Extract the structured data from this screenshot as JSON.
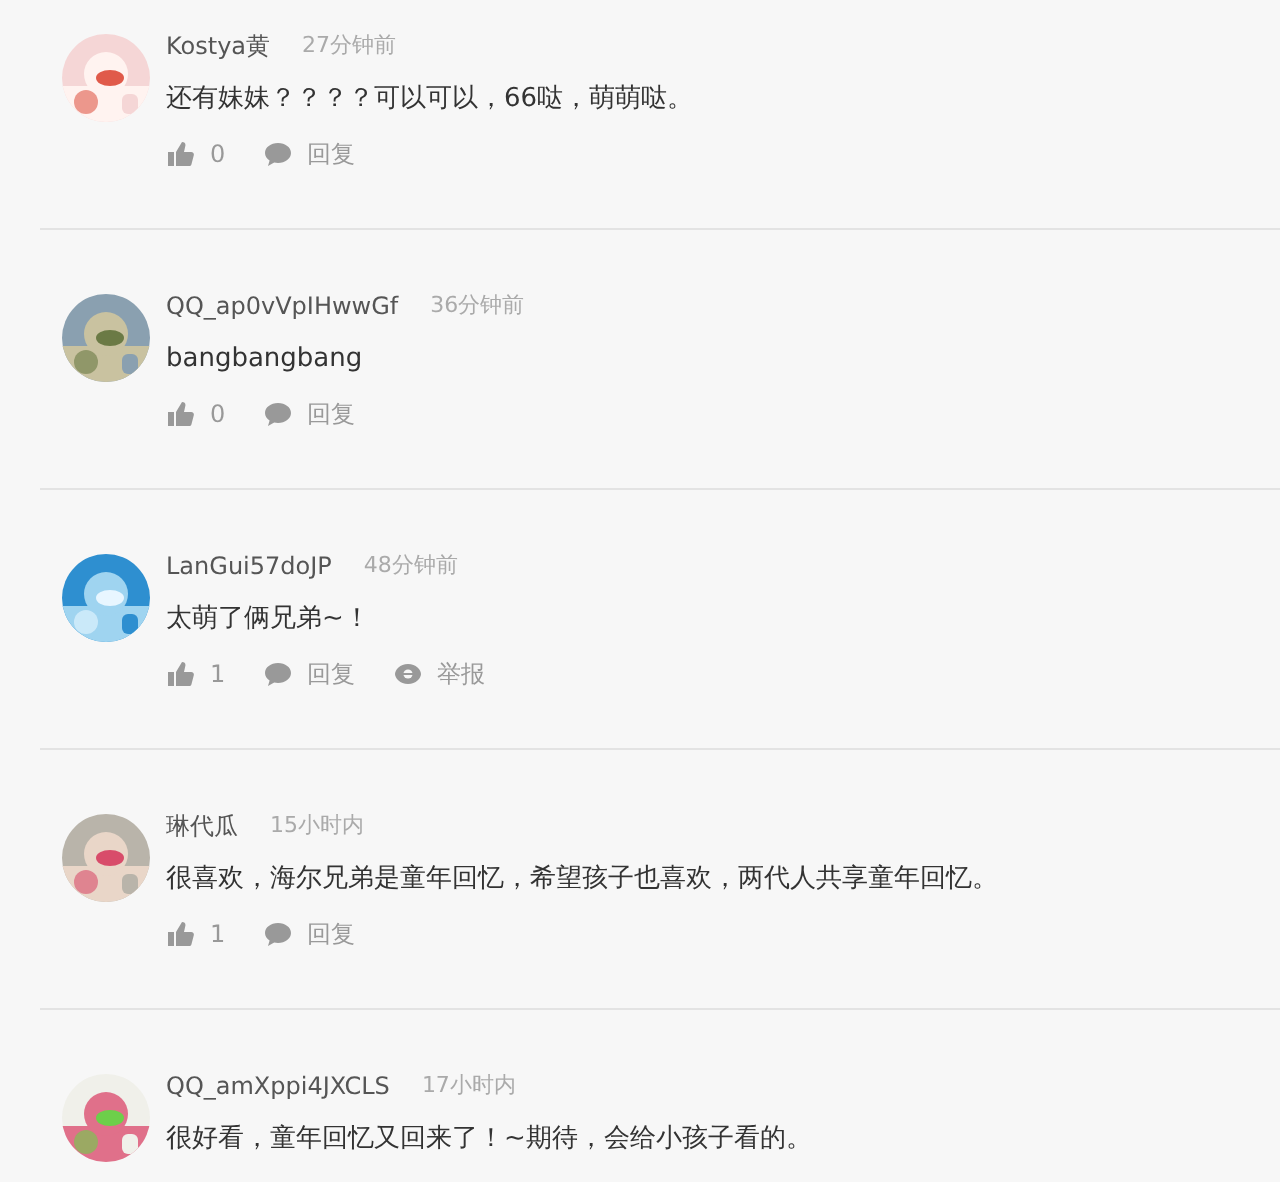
{
  "comments": [
    {
      "avatar": {
        "kind": "picture"
      },
      "username": "Kostya黄",
      "time": "27分钟前",
      "text": "还有妹妹？？？？可以可以，66哒，萌萌哒。",
      "actions": [
        {
          "kind": "like",
          "label": "0"
        },
        {
          "kind": "reply",
          "label": "回复"
        }
      ]
    },
    {
      "avatar": {
        "kind": "picture"
      },
      "username": "QQ_ap0vVpIHwwGf",
      "time": "36分钟前",
      "text": "bangbangbang",
      "actions": [
        {
          "kind": "like",
          "label": "0"
        },
        {
          "kind": "reply",
          "label": "回复"
        }
      ]
    },
    {
      "avatar": {
        "kind": "picture"
      },
      "username": "LanGui57doJP",
      "time": "48分钟前",
      "text": "太萌了俩兄弟~！",
      "actions": [
        {
          "kind": "like",
          "label": "1"
        },
        {
          "kind": "reply",
          "label": "回复"
        },
        {
          "kind": "report",
          "label": "举报"
        }
      ]
    },
    {
      "avatar": {
        "kind": "picture"
      },
      "username": "琳代瓜",
      "time": "15小时内",
      "text": "很喜欢，海尔兄弟是童年回忆，希望孩子也喜欢，两代人共享童年回忆。",
      "actions": [
        {
          "kind": "like",
          "label": "1"
        },
        {
          "kind": "reply",
          "label": "回复"
        }
      ]
    },
    {
      "avatar": {
        "kind": "picture"
      },
      "username": "QQ_amXppi4JXCLS",
      "time": "17小时内",
      "text": "很好看，童年回忆又回来了！~期待，会给小孩子看的。"
    }
  ]
}
